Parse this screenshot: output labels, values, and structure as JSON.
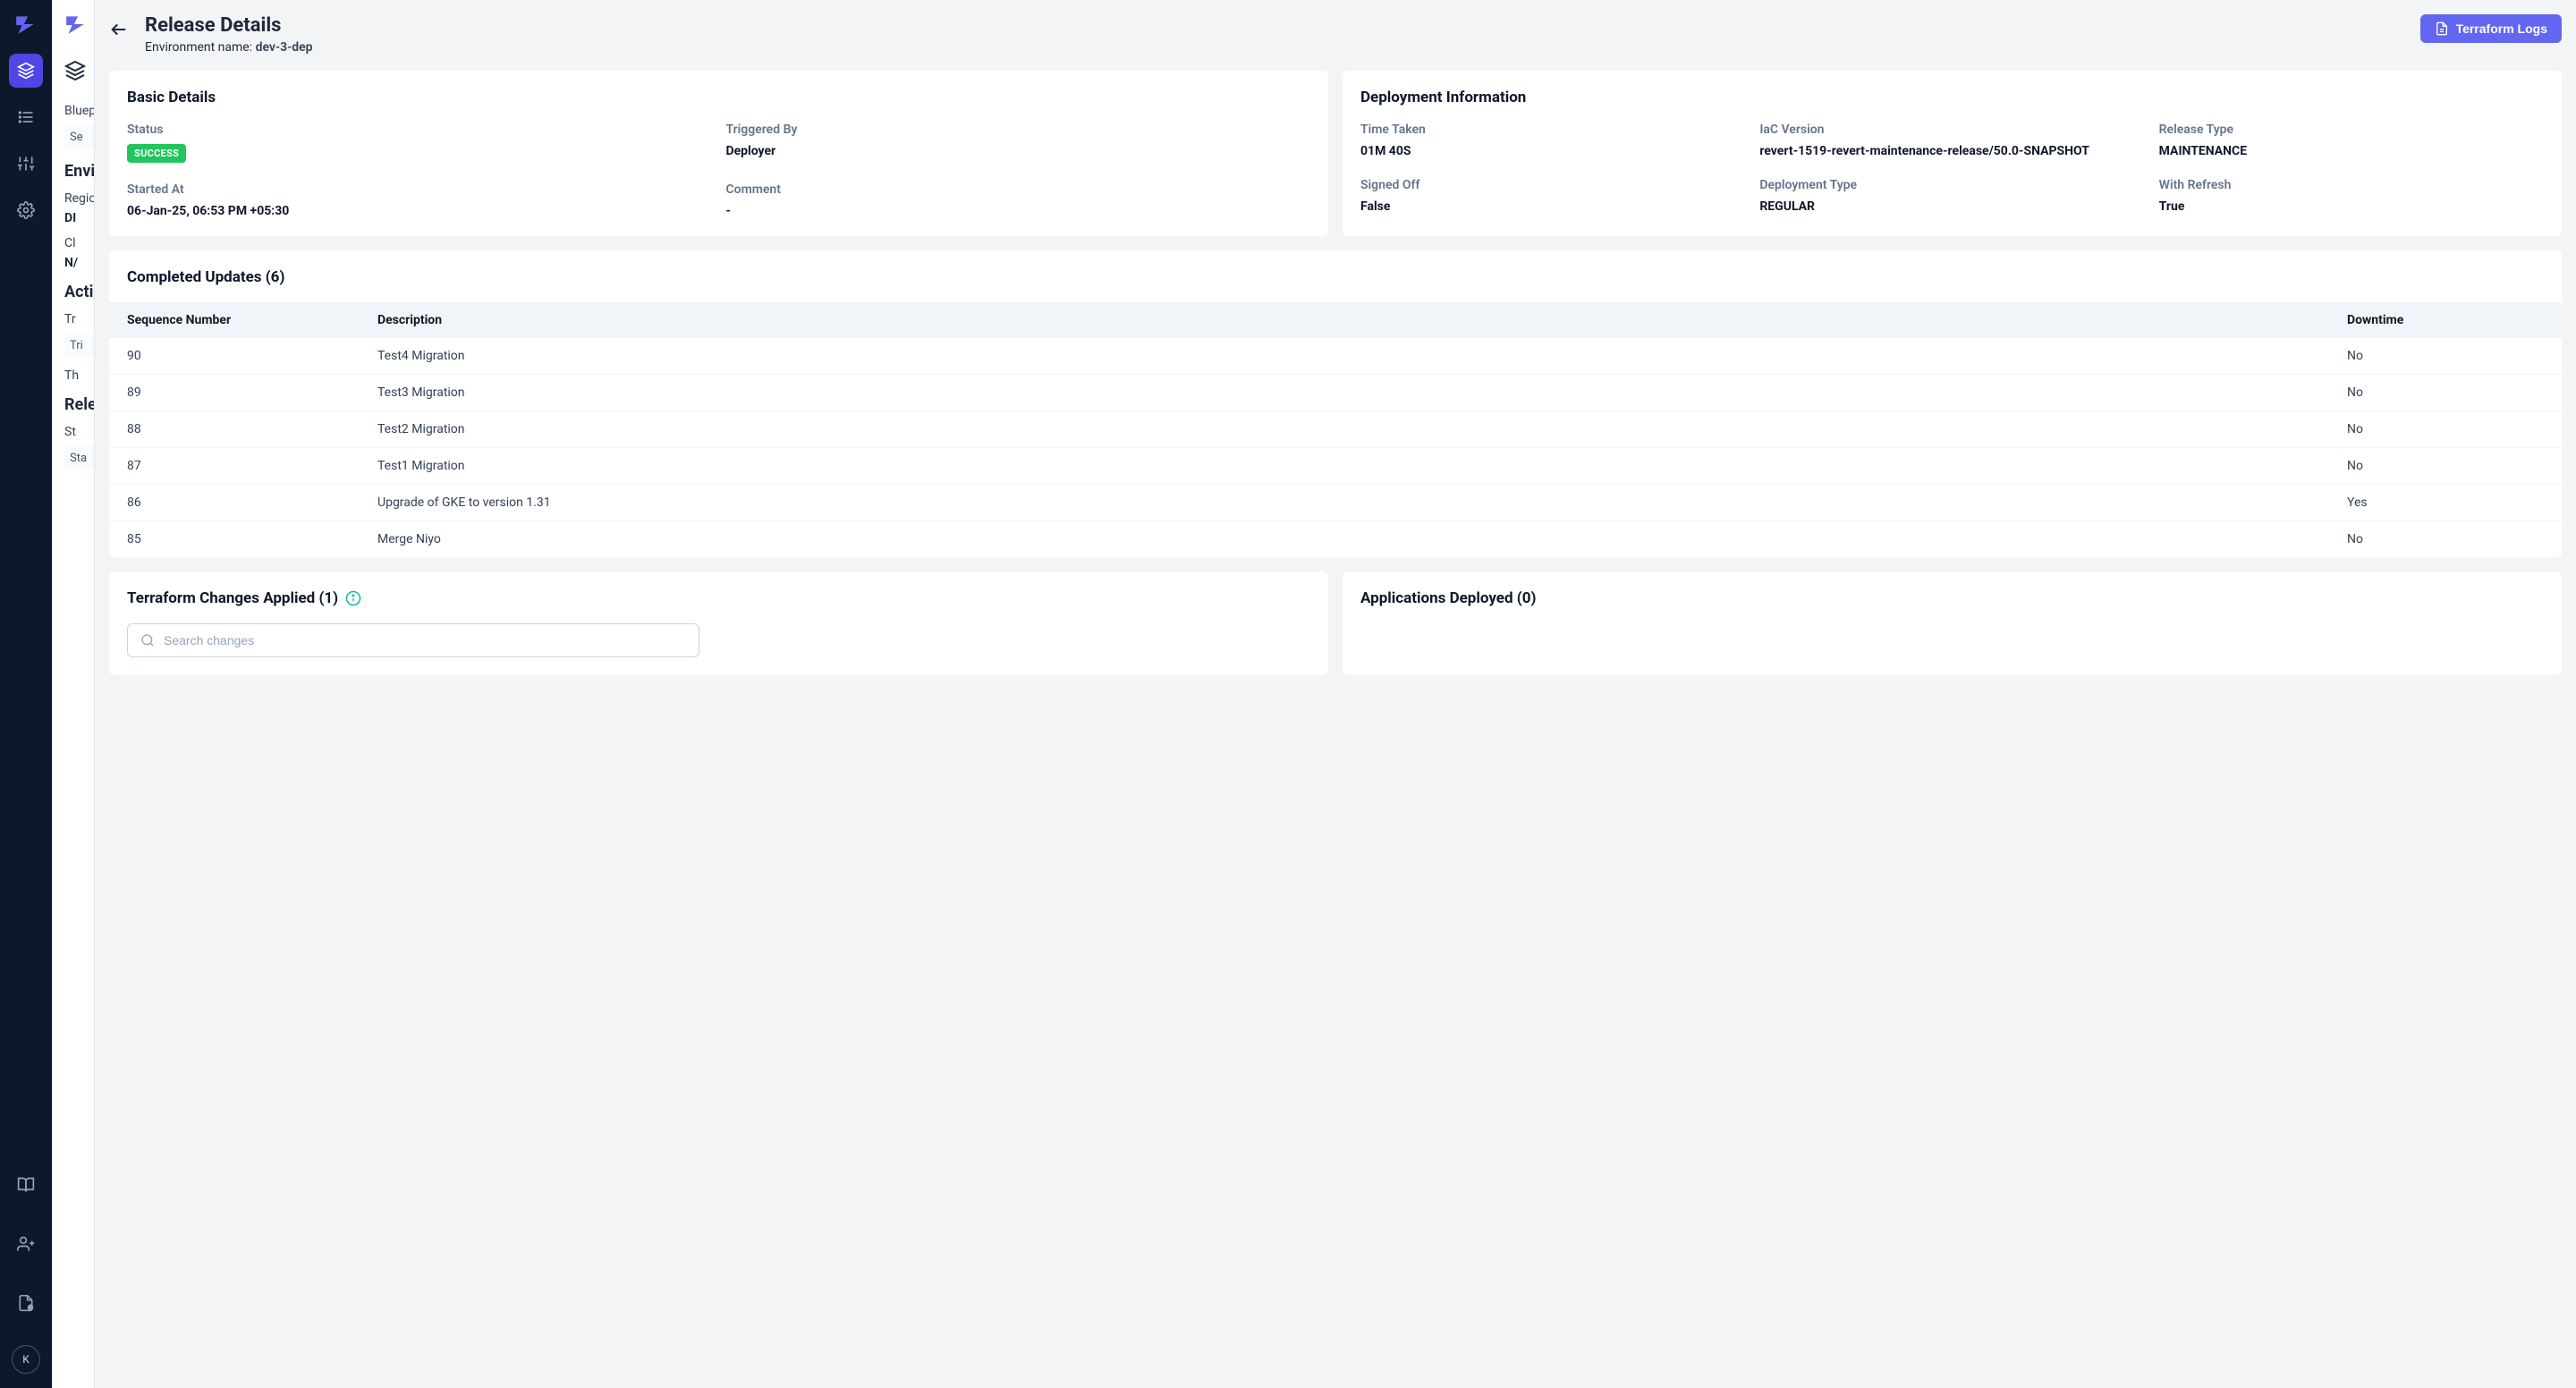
{
  "sidebar": {
    "avatar_initial": "K"
  },
  "inner_sidebar": {
    "blueprint_label": "Blueprint",
    "search_label": "Se",
    "env_heading": "Environment",
    "region_label": "Region",
    "region_value": "DI",
    "cluster_label": "Cl",
    "cluster_value": "N/",
    "actions_heading": "Actions",
    "trigger_label": "Tr",
    "trigger_box": "Tri",
    "thunder_label": "Th",
    "releases_heading": "Releases",
    "status_label": "St",
    "status_box": "Sta"
  },
  "header": {
    "title": "Release Details",
    "env_name_label": "Environment name: ",
    "env_name_value": "dev-3-dep",
    "terraform_logs_btn": "Terraform Logs"
  },
  "basic_details": {
    "title": "Basic Details",
    "status_label": "Status",
    "status_value": "SUCCESS",
    "triggered_by_label": "Triggered By",
    "triggered_by_value": "Deployer",
    "started_at_label": "Started At",
    "started_at_value": "06-Jan-25, 06:53 PM +05:30",
    "comment_label": "Comment",
    "comment_value": "-"
  },
  "deployment_info": {
    "title": "Deployment Information",
    "time_taken_label": "Time Taken",
    "time_taken_value": "01M 40S",
    "iac_version_label": "IaC Version",
    "iac_version_value": "revert-1519-revert-maintenance-release/50.0-SNAPSHOT",
    "release_type_label": "Release Type",
    "release_type_value": "MAINTENANCE",
    "signed_off_label": "Signed Off",
    "signed_off_value": "False",
    "deployment_type_label": "Deployment Type",
    "deployment_type_value": "REGULAR",
    "with_refresh_label": "With Refresh",
    "with_refresh_value": "True"
  },
  "completed_updates": {
    "title": "Completed Updates (6)",
    "columns": {
      "seq": "Sequence Number",
      "desc": "Description",
      "downtime": "Downtime"
    },
    "rows": [
      {
        "seq": "90",
        "desc": "Test4 Migration",
        "downtime": "No"
      },
      {
        "seq": "89",
        "desc": "Test3 Migration",
        "downtime": "No"
      },
      {
        "seq": "88",
        "desc": "Test2 Migration",
        "downtime": "No"
      },
      {
        "seq": "87",
        "desc": "Test1 Migration",
        "downtime": "No"
      },
      {
        "seq": "86",
        "desc": "Upgrade of GKE to version 1.31",
        "downtime": "Yes"
      },
      {
        "seq": "85",
        "desc": "Merge Niyo",
        "downtime": "No"
      }
    ]
  },
  "terraform_changes": {
    "title": "Terraform Changes Applied (1)",
    "search_placeholder": "Search changes"
  },
  "applications_deployed": {
    "title": "Applications Deployed (0)"
  }
}
